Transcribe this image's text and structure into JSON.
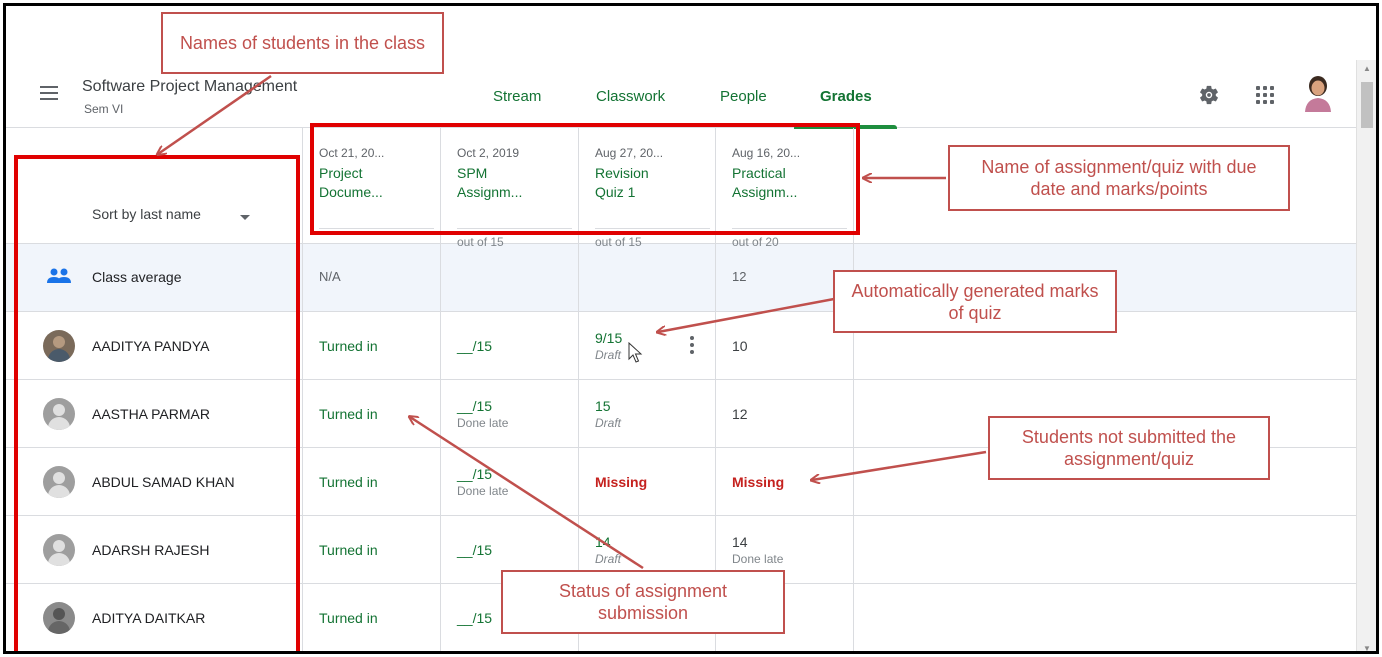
{
  "course": {
    "title": "Software Project Management",
    "section": "Sem VI"
  },
  "tabs": [
    {
      "label": "Stream"
    },
    {
      "label": "Classwork"
    },
    {
      "label": "People"
    },
    {
      "label": "Grades"
    }
  ],
  "icons": {
    "menu": "hamburger-icon",
    "settings": "gear-icon",
    "apps": "apps-grid-icon",
    "account": "account-avatar"
  },
  "sort": {
    "label": "Sort by last name"
  },
  "assignments": [
    {
      "date": "Oct 21, 20...",
      "title_line1": "Project",
      "title_line2": "Docume...",
      "points": ""
    },
    {
      "date": "Oct 2, 2019",
      "title_line1": "SPM",
      "title_line2": "Assignm...",
      "points": "out of 15"
    },
    {
      "date": "Aug 27, 20...",
      "title_line1": "Revision",
      "title_line2": "Quiz 1",
      "points": "out of 15"
    },
    {
      "date": "Aug 16, 20...",
      "title_line1": "Practical",
      "title_line2": "Assignm...",
      "points": "out of 20"
    }
  ],
  "class_average": {
    "label": "Class average",
    "values": [
      "N/A",
      "",
      "",
      "12"
    ]
  },
  "students": [
    {
      "name": "AADITYA PANDYA",
      "c1": "Turned in",
      "c2": "__/15",
      "c2_sub": "",
      "c3": "9/15",
      "c3_sub": "Draft",
      "c4": "10",
      "c4_sub": ""
    },
    {
      "name": "AASTHA PARMAR",
      "c1": "Turned in",
      "c2": "__/15",
      "c2_sub": "Done late",
      "c3": "15",
      "c3_sub": "Draft",
      "c4": "12",
      "c4_sub": ""
    },
    {
      "name": "ABDUL SAMAD KHAN",
      "c1": "Turned in",
      "c2": "__/15",
      "c2_sub": "Done late",
      "c3": "Missing",
      "c3_sub": "",
      "c4": "Missing",
      "c4_sub": ""
    },
    {
      "name": "ADARSH RAJESH",
      "c1": "Turned in",
      "c2": "__/15",
      "c2_sub": "",
      "c3": "14",
      "c3_sub": "Draft",
      "c4": "14",
      "c4_sub": "Done late"
    },
    {
      "name": "ADITYA DAITKAR",
      "c1": "Turned in",
      "c2": "__/15",
      "c2_sub": "",
      "c3": "",
      "c3_sub": "",
      "c4": "",
      "c4_sub": ""
    }
  ],
  "annotations": {
    "names": "Names of students in the class",
    "assignment": "Name of assignment/quiz with due date and marks/points",
    "auto_marks": "Automatically generated marks of quiz",
    "not_submitted": "Students not submitted the assignment/quiz",
    "status": "Status of assignment submission"
  },
  "colors": {
    "accent": "#137333",
    "missing": "#c5221f",
    "annotation": "#c0504d",
    "highlight": "#e00000",
    "average_bg": "#f1f5fb"
  }
}
